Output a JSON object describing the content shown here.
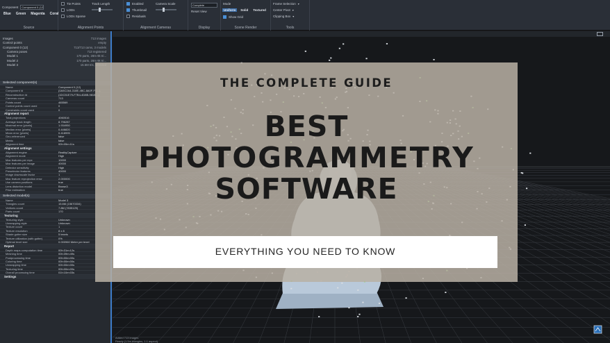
{
  "ribbon": {
    "source": {
      "label": "Source",
      "component_label": "Component",
      "component_value": "Component 0 (12)",
      "chips": [
        "Blue",
        "Green",
        "Magenta",
        "Coral"
      ]
    },
    "alignment_points": {
      "label": "Alignment Points",
      "checks": [
        "Tie Points",
        "LODs",
        "LODs Sparse"
      ],
      "track_label": "Track Length"
    },
    "alignment_cameras": {
      "label": "Alignment Cameras",
      "checks": [
        "Enabled",
        "Thumbnail",
        "Residuals"
      ],
      "camera_scale_label": "Camera Scale"
    },
    "display": {
      "label": "Display",
      "dropdown": "Complete",
      "reset_view": "Reset View"
    },
    "scene_render": {
      "label": "Scene Render",
      "mode_label": "Mode",
      "modes": [
        "Uniform",
        "Solid",
        "Textured"
      ],
      "show_grid": "Show Grid"
    },
    "tools": {
      "label": "Tools",
      "items": [
        "Frame Selection",
        "Center Pivot",
        "Clipping Box"
      ]
    }
  },
  "tree": {
    "items": [
      {
        "label": "Images",
        "value": "713 images"
      },
      {
        "label": "Control points",
        "value": "empty"
      },
      {
        "label": "Component 0 (12)",
        "value": "713/713 cams, 3 models"
      },
      {
        "label": "Camera poses",
        "value": "713 registered"
      },
      {
        "label": "Model 1",
        "value": "170 parts, 28m 9k tri..."
      },
      {
        "label": "Model 2",
        "value": "170 parts, 28m 9k tri..."
      },
      {
        "label": "Model 3",
        "value": "15.6M tris, selected"
      }
    ]
  },
  "component_panel": {
    "title": "Selected component(s)",
    "rows": [
      {
        "k": "Name",
        "v": "Component 0 (12)"
      },
      {
        "k": "Component Id",
        "v": "{0A5C2A4-318E-4BC-8A0F-FC...}"
      },
      {
        "k": "Reconstruction Id",
        "v": "{1DC51E79-F7B4-4D8B-9815-...}"
      },
      {
        "k": "Cameras count",
        "v": "713"
      },
      {
        "k": "Points count",
        "v": "465569"
      },
      {
        "k": "Control points count used",
        "v": "0"
      },
      {
        "k": "Constraints count used",
        "v": "0"
      }
    ],
    "alignment_report": {
      "title": "Alignment report",
      "rows": [
        {
          "k": "Total projections",
          "v": "4060516"
        },
        {
          "k": "Average track length",
          "v": "8.796287"
        },
        {
          "k": "Maximal error [pixels]",
          "v": "1.934950"
        },
        {
          "k": "Median error [pixels]",
          "v": "0.446820"
        },
        {
          "k": "Mean error [pixels]",
          "v": "0.418995"
        },
        {
          "k": "Geo-referenced",
          "v": "false"
        },
        {
          "k": "Metric",
          "v": "false"
        },
        {
          "k": "Alignment time",
          "v": "00h:05m:11s"
        }
      ]
    },
    "alignment_settings": {
      "title": "Alignment settings",
      "rows": [
        {
          "k": "Alignment engine",
          "v": "RealityCapture"
        },
        {
          "k": "Alignment mode",
          "v": "High"
        },
        {
          "k": "Max features per mpx",
          "v": "10000"
        },
        {
          "k": "Max features per image",
          "v": "40000"
        },
        {
          "k": "Detector sensitivity",
          "v": "High"
        },
        {
          "k": "Preselector features",
          "v": "40000"
        },
        {
          "k": "Image downscale factor",
          "v": "1"
        },
        {
          "k": "Max feature reprojection error",
          "v": "2.000000"
        },
        {
          "k": "Use camera positions",
          "v": "true"
        },
        {
          "k": "Lens distortion model",
          "v": "Brown3"
        },
        {
          "k": "Prior estimation",
          "v": "true"
        }
      ]
    }
  },
  "model_panel": {
    "title": "Selected model(s)",
    "rows": [
      {
        "k": "Name",
        "v": "Model 3"
      },
      {
        "k": "Triangles count",
        "v": "15.6M (15670334)"
      },
      {
        "k": "Vertices count",
        "v": "7.8M (7835129)"
      },
      {
        "k": "Parts count",
        "v": "170"
      }
    ],
    "texturing": {
      "title": "Texturing",
      "rows": [
        {
          "k": "Texturing style",
          "v": "Unknown"
        },
        {
          "k": "Unwrapping style",
          "v": "Unknown"
        },
        {
          "k": "Texture count",
          "v": "1"
        },
        {
          "k": "Texture resolution",
          "v": "8 x 8"
        },
        {
          "k": "Shade gutter size",
          "v": "5 texels"
        },
        {
          "k": "Texture utilization (with gutter)",
          "v": "0%"
        },
        {
          "k": "Optimal texel size",
          "v": "0.000960 Meter per texel"
        }
      ]
    },
    "report": {
      "title": "Report",
      "rows": [
        {
          "k": "Depth maps computation time",
          "v": "00h:31m:12s"
        },
        {
          "k": "Meshing time",
          "v": "00h:39m:49s"
        },
        {
          "k": "Postprocessing time",
          "v": "00h:00m:00s"
        },
        {
          "k": "Coloring time",
          "v": "00h:00m:00s"
        },
        {
          "k": "Unwrapping time",
          "v": "00h:00m:00s"
        },
        {
          "k": "Texturing time",
          "v": "00h:00m:00s"
        },
        {
          "k": "Overall processing time",
          "v": "01h:10m:03s"
        }
      ]
    },
    "settings_title": "Settings"
  },
  "viewport": {
    "status_line1": "Added 713 images",
    "status_line2": "Ready (1.5m triangles, 1:1 aspect)"
  },
  "overlay": {
    "subtitle": "THE COMPLETE GUIDE",
    "title_lines": [
      "BEST",
      "PHOTOGRAMMETRY",
      "SOFTWARE"
    ],
    "banner": "EVERYTHING YOU NEED TO KNOW"
  },
  "colors": {
    "accent": "#3d7cc9",
    "ribbon_bg": "#2a2f37",
    "viewport_bg": "#16181b",
    "card_bg": "#b8b0a4",
    "banner_bg": "#ffffff"
  }
}
